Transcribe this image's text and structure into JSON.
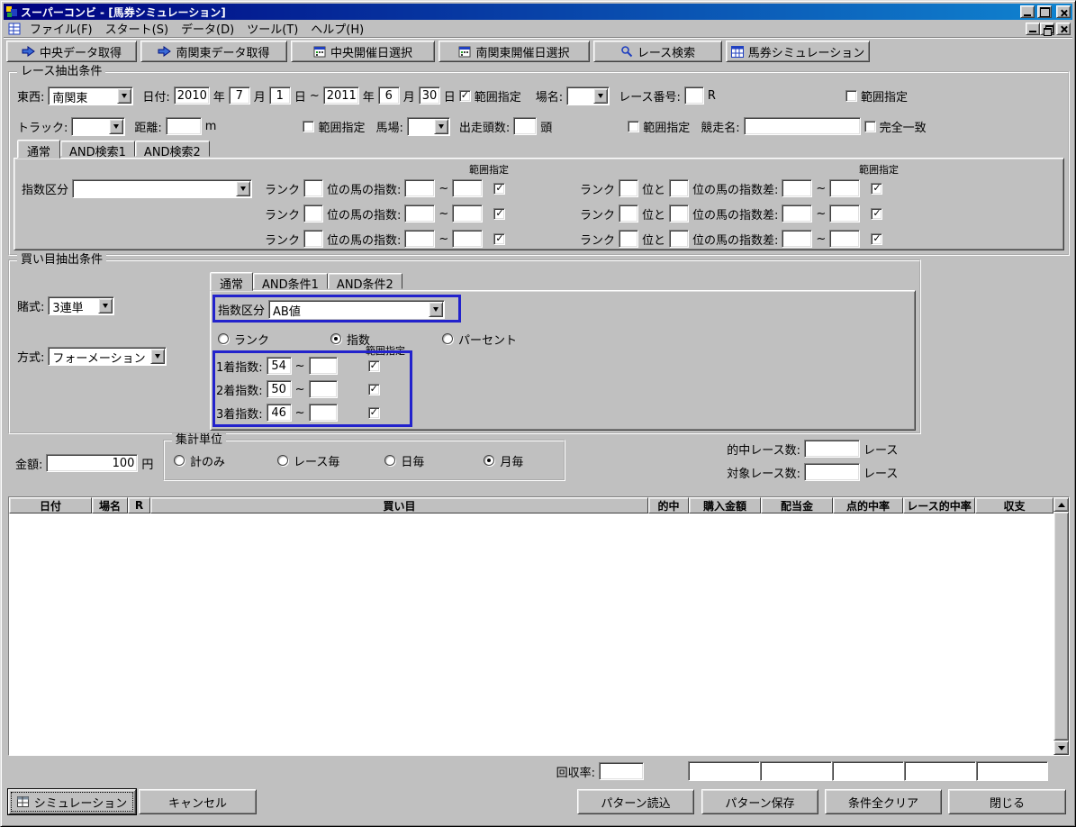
{
  "window": {
    "title": "スーパーコンビ - [馬券シミュレーション]"
  },
  "menu": {
    "items": [
      "ファイル(F)",
      "スタート(S)",
      "データ(D)",
      "ツール(T)",
      "ヘルプ(H)"
    ]
  },
  "toolbar": {
    "buttons": [
      {
        "label": "中央データ取得",
        "icon": "arrow-import-icon"
      },
      {
        "label": "南関東データ取得",
        "icon": "arrow-import-icon"
      },
      {
        "label": "中央開催日選択",
        "icon": "calendar-icon"
      },
      {
        "label": "南関東開催日選択",
        "icon": "calendar-icon"
      },
      {
        "label": "レース検索",
        "icon": "search-icon"
      },
      {
        "label": "馬券シミュレーション",
        "icon": "grid-icon"
      }
    ]
  },
  "race": {
    "group_title": "レース抽出条件",
    "east_west_label": "東西:",
    "east_west_value": "南関東",
    "date_label": "日付:",
    "from_year": "2010",
    "from_month": "7",
    "from_day": "1",
    "to_year": "2011",
    "to_month": "6",
    "to_day": "30",
    "year_unit": "年",
    "month_unit": "月",
    "day_unit": "日",
    "tilde": "~",
    "range_label": "範囲指定",
    "place_label": "場名:",
    "place_value": "",
    "race_no_label": "レース番号:",
    "race_no_value": "",
    "race_no_unit": "R",
    "track_label": "トラック:",
    "track_value": "",
    "distance_label": "距離:",
    "distance_value": "",
    "distance_unit": "m",
    "baba_label": "馬場:",
    "baba_value": "",
    "runners_label": "出走頭数:",
    "runners_value": "",
    "runners_unit": "頭",
    "race_name_label": "競走名:",
    "race_name_value": "",
    "exact_label": "完全一致",
    "tabs": [
      "通常",
      "AND検索1",
      "AND検索2"
    ],
    "index_class_label": "指数区分",
    "index_class_value": "",
    "rank_label": "ランク",
    "rank_index_label": "位の馬の指数:",
    "rank_and_label": "位と",
    "rank_diff_label": "位の馬の指数差:",
    "rank_rows": [
      {
        "rank": "",
        "from": "",
        "to": ""
      },
      {
        "rank": "",
        "from": "",
        "to": ""
      },
      {
        "rank": "",
        "from": "",
        "to": ""
      }
    ],
    "diff_rows": [
      {
        "rank1": "",
        "rank2": "",
        "from": "",
        "to": ""
      },
      {
        "rank1": "",
        "rank2": "",
        "from": "",
        "to": ""
      },
      {
        "rank1": "",
        "rank2": "",
        "from": "",
        "to": ""
      }
    ]
  },
  "bet": {
    "group_title": "買い目抽出条件",
    "bet_type_label": "賭式:",
    "bet_type_value": "3連単",
    "method_label": "方式:",
    "method_value": "フォーメーション",
    "tabs": [
      "通常",
      "AND条件1",
      "AND条件2"
    ],
    "index_class_label": "指数区分",
    "index_class_value": "AB値",
    "radio_rank": "ランク",
    "radio_index": "指数",
    "radio_percent": "パーセント",
    "radio_selected": "指数",
    "range_label": "範囲指定",
    "tilde": "~",
    "rows": [
      {
        "label": "1着指数:",
        "from": "54",
        "to": ""
      },
      {
        "label": "2着指数:",
        "from": "50",
        "to": ""
      },
      {
        "label": "3着指数:",
        "from": "46",
        "to": ""
      }
    ]
  },
  "amount": {
    "label": "金額:",
    "value": "100",
    "unit": "円"
  },
  "aggregate": {
    "group_title": "集計単位",
    "options": [
      "計のみ",
      "レース毎",
      "日毎",
      "月毎"
    ],
    "selected": "月毎"
  },
  "counters": {
    "hit_label": "的中レース数:",
    "hit_value": "",
    "target_label": "対象レース数:",
    "target_value": "",
    "unit": "レース"
  },
  "results_table": {
    "headers": [
      "日付",
      "場名",
      "R",
      "買い目",
      "的中",
      "購入金額",
      "配当金",
      "点的中率",
      "レース的中率",
      "収支"
    ],
    "rows": []
  },
  "footer": {
    "recovery_label": "回収率:",
    "recovery_value": "",
    "buttons": {
      "simulation": "シミュレーション",
      "cancel": "キャンセル",
      "load": "パターン読込",
      "save": "パターン保存",
      "clear": "条件全クリア",
      "close": "閉じる"
    }
  },
  "colors": {
    "titlebar_left": "#000080",
    "titlebar_right": "#1084d0",
    "window_bg": "#c0c0c0",
    "highlight_box": "#2222cc"
  }
}
